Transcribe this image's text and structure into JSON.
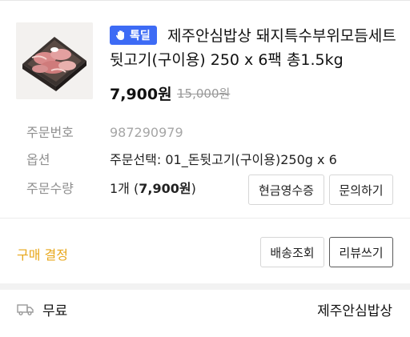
{
  "product": {
    "badge": "톡딜",
    "title": "제주안심밥상 돼지특수부위모듬세트 뒷고기(구이용) 250 x 6팩 총1.5kg",
    "price": "7,900원",
    "original_price": "15,000원"
  },
  "order": {
    "number_label": "주문번호",
    "number_value": "987290979",
    "option_label": "옵션",
    "option_value": "주문선택: 01_돈뒷고기(구이용)250g x 6",
    "qty_label": "주문수량",
    "qty_prefix": "1개 (",
    "qty_amount": "7,900원",
    "qty_suffix": ")"
  },
  "buttons": {
    "cash_receipt": "현금영수증",
    "inquiry": "문의하기",
    "track_shipping": "배송조회",
    "write_review": "리뷰쓰기"
  },
  "decision_label": "구매 결정",
  "shipping": {
    "icon": "truck-icon",
    "fee_label": "무료",
    "seller": "제주안심밥상"
  },
  "colors": {
    "badge_bg": "#3d6bf5",
    "decision_text": "#e8a71a"
  }
}
